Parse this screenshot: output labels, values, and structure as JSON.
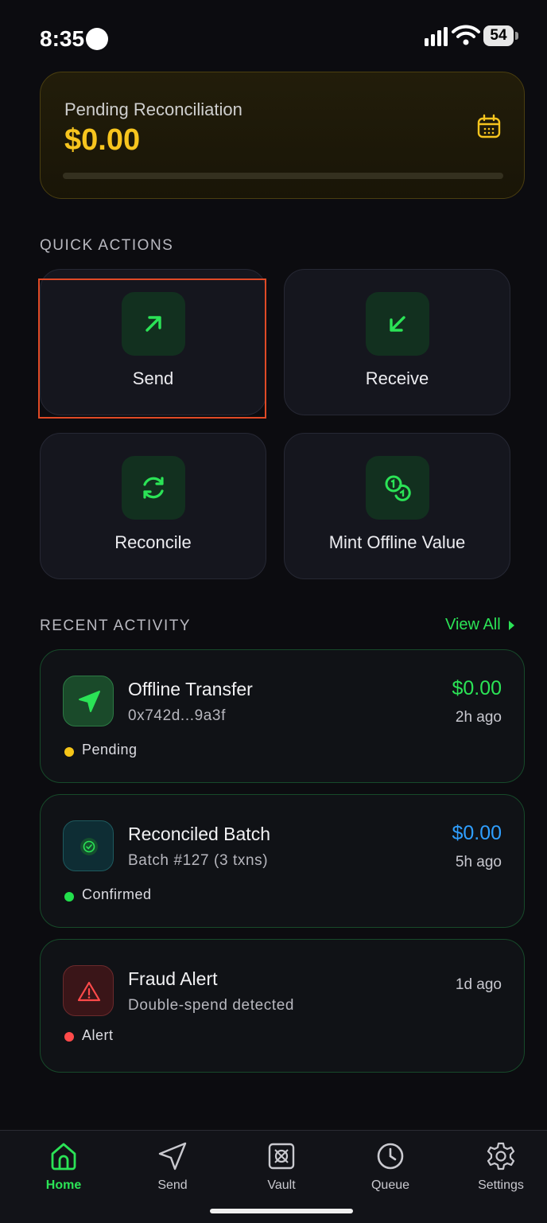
{
  "status_bar": {
    "time": "8:35",
    "battery": "54"
  },
  "pending": {
    "label": "Pending Reconciliation",
    "amount": "$0.00",
    "icon": "calendar-icon"
  },
  "quick_actions": {
    "title": "QUICK ACTIONS",
    "items": [
      {
        "label": "Send",
        "icon": "arrow-up-right-icon"
      },
      {
        "label": "Receive",
        "icon": "arrow-down-left-icon"
      },
      {
        "label": "Reconcile",
        "icon": "refresh-icon"
      },
      {
        "label": "Mint Offline Value",
        "icon": "coins-icon"
      }
    ]
  },
  "recent_activity": {
    "title": "RECENT ACTIVITY",
    "view_all": "View All",
    "items": [
      {
        "title": "Offline Transfer",
        "subtitle": "0x742d...9a3f",
        "amount": "$0.00",
        "time": "2h ago",
        "status": "Pending",
        "status_color": "#f5c518",
        "amount_color": "#2be356",
        "icon": "send-arrow-icon"
      },
      {
        "title": "Reconciled Batch",
        "subtitle": "Batch #127 (3 txns)",
        "amount": "$0.00",
        "time": "5h ago",
        "status": "Confirmed",
        "status_color": "#22e04c",
        "amount_color": "#2f9fff",
        "icon": "check-circle-icon"
      },
      {
        "title": "Fraud Alert",
        "subtitle": "Double-spend detected",
        "amount": "",
        "time": "1d ago",
        "status": "Alert",
        "status_color": "#ff4a4a",
        "amount_color": "#ffffff",
        "icon": "warning-icon"
      }
    ]
  },
  "tabs": [
    {
      "label": "Home",
      "icon": "home-icon",
      "active": true
    },
    {
      "label": "Send",
      "icon": "send-icon",
      "active": false
    },
    {
      "label": "Vault",
      "icon": "vault-icon",
      "active": false
    },
    {
      "label": "Queue",
      "icon": "clock-icon",
      "active": false
    },
    {
      "label": "Settings",
      "icon": "gear-icon",
      "active": false
    }
  ],
  "colors": {
    "accent": "#2be356",
    "gold": "#f7c51e",
    "background": "#0c0c10"
  }
}
